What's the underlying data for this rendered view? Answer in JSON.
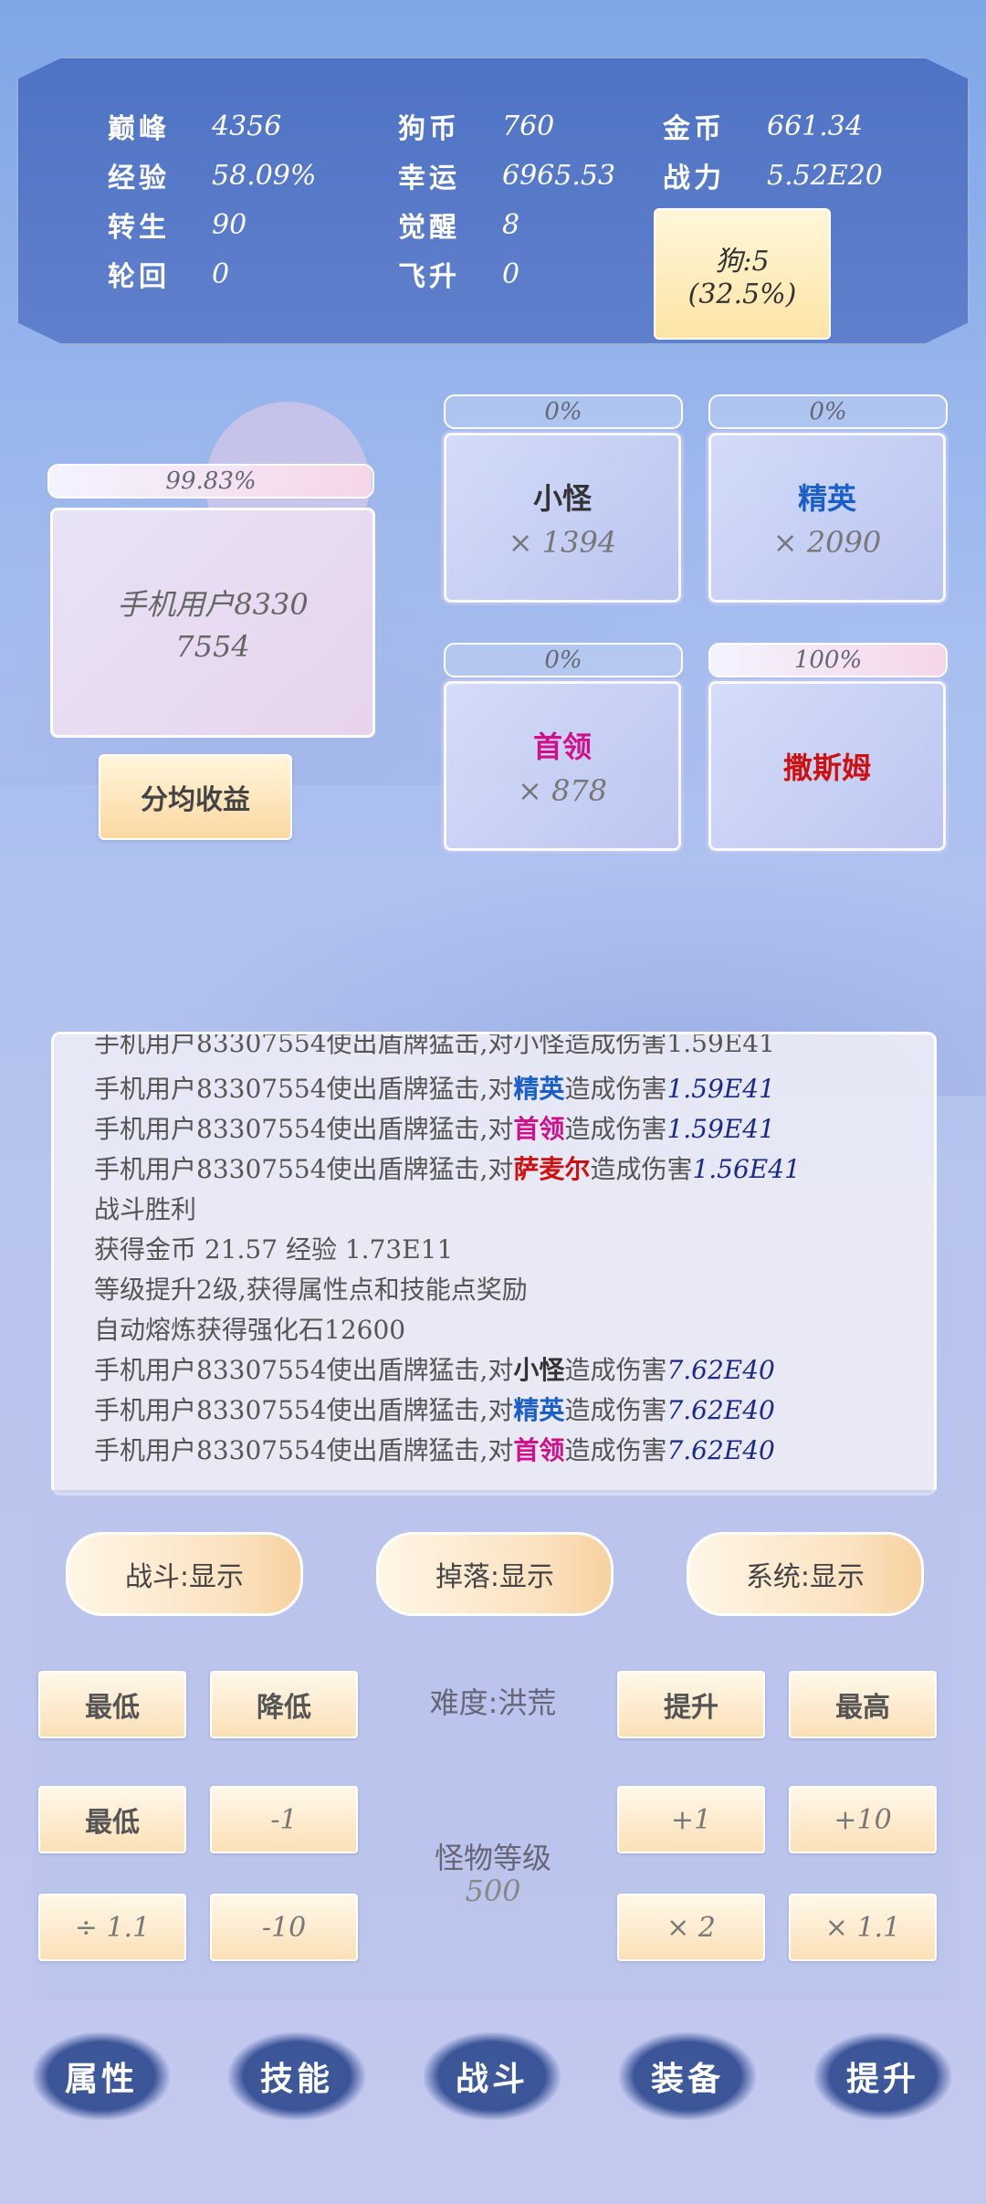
{
  "stats": {
    "row1": [
      {
        "key": "巅峰",
        "value": "4356"
      },
      {
        "key": "狗币",
        "value": "760"
      },
      {
        "key": "金币",
        "value": "661.34"
      }
    ],
    "row2": [
      {
        "key": "经验",
        "value": "58.09%"
      },
      {
        "key": "幸运",
        "value": "6965.53"
      },
      {
        "key": "战力",
        "value": "5.52E20"
      }
    ],
    "row3": [
      {
        "key": "转生",
        "value": "90"
      },
      {
        "key": "觉醒",
        "value": "8"
      }
    ],
    "row4": [
      {
        "key": "轮回",
        "value": "0"
      },
      {
        "key": "飞升",
        "value": "0"
      }
    ],
    "dog": {
      "line1": "狗:5",
      "line2": "(32.5%)"
    }
  },
  "player": {
    "progress": "99.83%",
    "progress_fraction": 0.9983,
    "name_line1": "手机用户8330",
    "name_line2": "7554"
  },
  "share_button": "分均收益",
  "enemies": [
    {
      "progress": "0%",
      "fraction": 0,
      "name": "小怪",
      "count": "× 1394",
      "color": "#333333"
    },
    {
      "progress": "0%",
      "fraction": 0,
      "name": "精英",
      "count": "× 2090",
      "color": "#1a5fc7"
    },
    {
      "progress": "0%",
      "fraction": 0,
      "name": "首领",
      "count": "× 878",
      "color": "#d0108b"
    },
    {
      "progress": "100%",
      "fraction": 1,
      "name": "撒斯姆",
      "count": "",
      "color": "#d01010"
    }
  ],
  "log": {
    "partial_line": "手机用户83307554使出盾牌猛击,对小怪造成伤害1.59E41",
    "lines": [
      {
        "pre": "手机用户83307554使出盾牌猛击,对",
        "target": "精英",
        "post": "造成伤害",
        "dmg": "1.59E41",
        "cls": "c-blue"
      },
      {
        "pre": "手机用户83307554使出盾牌猛击,对",
        "target": "首领",
        "post": "造成伤害",
        "dmg": "1.59E41",
        "cls": "c-mag"
      },
      {
        "pre": "手机用户83307554使出盾牌猛击,对",
        "target": "萨麦尔",
        "post": "造成伤害",
        "dmg": "1.56E41",
        "cls": "c-red"
      }
    ],
    "victory": "战斗胜利",
    "reward": "获得金币 21.57  经验 1.73E11",
    "levelup": "等级提升2级,获得属性点和技能点奖励",
    "smelt": "自动熔炼获得强化石12600",
    "lines2": [
      {
        "pre": "手机用户83307554使出盾牌猛击,对",
        "target": "小怪",
        "post": "造成伤害",
        "dmg": "7.62E40",
        "cls": "c-dark"
      },
      {
        "pre": "手机用户83307554使出盾牌猛击,对",
        "target": "精英",
        "post": "造成伤害",
        "dmg": "7.62E40",
        "cls": "c-blue"
      },
      {
        "pre": "手机用户83307554使出盾牌猛击,对",
        "target": "首领",
        "post": "造成伤害",
        "dmg": "7.62E40",
        "cls": "c-mag"
      }
    ]
  },
  "filters": {
    "battle": "战斗:显示",
    "drop": "掉落:显示",
    "system": "系统:显示"
  },
  "difficulty": {
    "label": "难度:洪荒",
    "lowest": "最低",
    "lower": "降低",
    "raise": "提升",
    "highest": "最高"
  },
  "monster_level": {
    "label": "怪物等级",
    "value": "500",
    "min": "最低",
    "minus1": "-1",
    "plus1": "+1",
    "plus10": "+10",
    "div11": "÷ 1.1",
    "minus10": "-10",
    "times2": "× 2",
    "times11": "× 1.1"
  },
  "nav": [
    "属性",
    "技能",
    "战斗",
    "装备",
    "提升"
  ]
}
